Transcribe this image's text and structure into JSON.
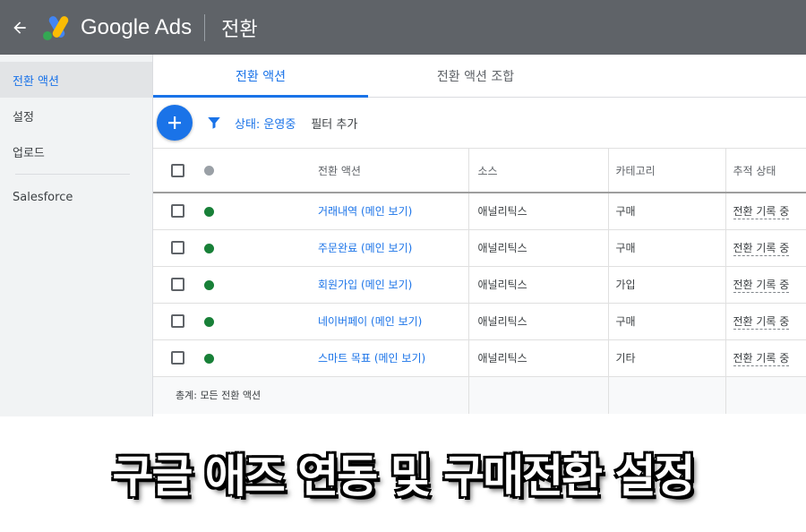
{
  "header": {
    "brand": "Google Ads",
    "title": "전환",
    "back_icon": "arrow-left-icon",
    "logo_icon": "google-ads-logo"
  },
  "sidebar": {
    "items": [
      {
        "label": "전환 액션",
        "active": true
      },
      {
        "label": "설정",
        "active": false
      },
      {
        "label": "업로드",
        "active": false
      },
      {
        "label": "Salesforce",
        "active": false
      }
    ]
  },
  "tabs": [
    {
      "label": "전환 액션",
      "active": true
    },
    {
      "label": "전환 액션 조합",
      "active": false
    }
  ],
  "filters": {
    "add_icon": "plus-icon",
    "filter_icon": "funnel-icon",
    "status_chip": "상태: 운영중",
    "add_filter": "필터 추가"
  },
  "table": {
    "columns": [
      "전환 액션",
      "소스",
      "카테고리",
      "추적 상태"
    ],
    "rows": [
      {
        "name": "거래내역 (메인 보기)",
        "source": "애널리틱스",
        "category": "구매",
        "status": "전환 기록 중"
      },
      {
        "name": "주문완료 (메인 보기)",
        "source": "애널리틱스",
        "category": "구매",
        "status": "전환 기록 중"
      },
      {
        "name": "회원가입 (메인 보기)",
        "source": "애널리틱스",
        "category": "가입",
        "status": "전환 기록 중"
      },
      {
        "name": "네이버페이 (메인 보기)",
        "source": "애널리틱스",
        "category": "구매",
        "status": "전환 기록 중"
      },
      {
        "name": "스마트 목표 (메인 보기)",
        "source": "애널리틱스",
        "category": "기타",
        "status": "전환 기록 중"
      }
    ],
    "total_label": "총계: 모든 전환 액션"
  },
  "banner": {
    "text": "구글 애즈 연동 및 구매전환 설정"
  },
  "colors": {
    "accent": "#1a73e8",
    "topbar": "#5f6368",
    "status_active": "#188038"
  }
}
